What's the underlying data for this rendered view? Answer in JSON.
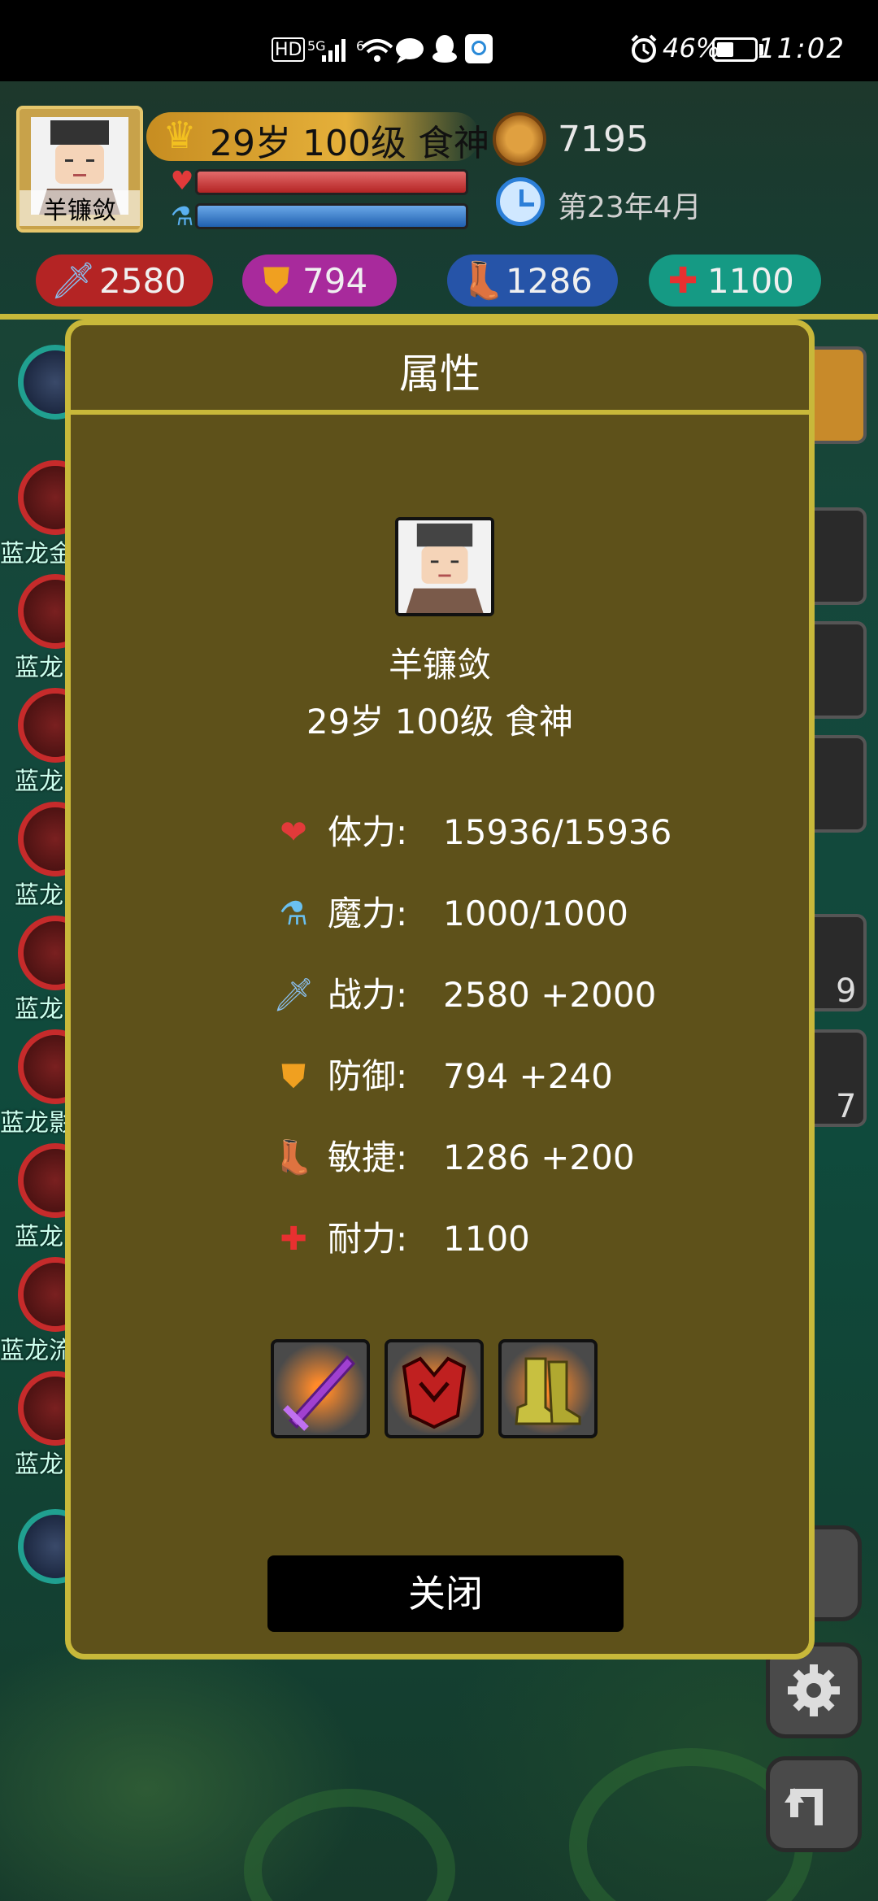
{
  "status_bar": {
    "network": "HD",
    "signal": "5G",
    "wifi": "6",
    "battery_percent": "46%",
    "battery_level": 0.46,
    "time": "11:02"
  },
  "player": {
    "name": "羊镰敛",
    "level_line": "29岁 100级 食神",
    "coins": "7195",
    "date": "第23年4月",
    "hp_fraction": 1.0,
    "mp_fraction": 1.0
  },
  "hud_stats": [
    {
      "icon": "sword-icon",
      "value": "2580",
      "color": "#c62b2b"
    },
    {
      "icon": "shield-icon",
      "value": "794",
      "color": "#b52aa8"
    },
    {
      "icon": "boot-icon",
      "value": "1286",
      "color": "#2654a8"
    },
    {
      "icon": "heart-plus-icon",
      "value": "1100",
      "color": "#1aa890"
    }
  ],
  "left_list_labels": [
    "蓝龙金",
    "蓝龙",
    "蓝龙",
    "蓝龙",
    "蓝龙",
    "蓝龙影",
    "蓝龙",
    "蓝龙流",
    "蓝龙"
  ],
  "right_counts": [
    "9",
    "7"
  ],
  "popup": {
    "title": "属性",
    "name": "羊镰敛",
    "level_line": "29岁 100级 食神",
    "attributes": [
      {
        "icon": "heart-icon",
        "label": "体力:",
        "value": "15936/15936"
      },
      {
        "icon": "mana-potion-icon",
        "label": "魔力:",
        "value": "1000/1000"
      },
      {
        "icon": "sword-icon",
        "label": "战力:",
        "value": "2580 +2000"
      },
      {
        "icon": "shield-icon",
        "label": "防御:",
        "value": "794 +240"
      },
      {
        "icon": "boot-icon",
        "label": "敏捷:",
        "value": "1286 +200"
      },
      {
        "icon": "heart-plus-icon",
        "label": "耐力:",
        "value": "1100"
      }
    ],
    "equipment": [
      "purple-sword-icon",
      "demon-armor-icon",
      "golden-boots-icon"
    ],
    "close_label": "关闭"
  }
}
